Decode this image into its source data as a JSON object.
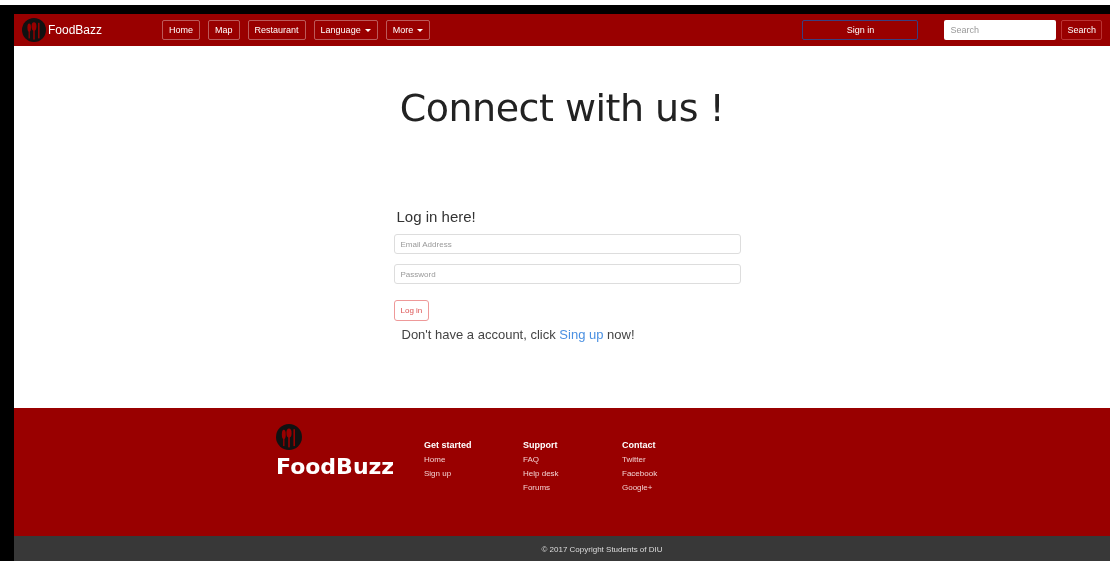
{
  "navbar": {
    "brand": "FoodBazz",
    "links": [
      {
        "label": "Home",
        "kind": "link"
      },
      {
        "label": "Map",
        "kind": "link"
      },
      {
        "label": "Restaurant",
        "kind": "link"
      },
      {
        "label": "Language",
        "kind": "dropdown"
      },
      {
        "label": "More",
        "kind": "dropdown"
      }
    ],
    "sign_in": "Sign in",
    "search": {
      "placeholder": "Search",
      "button": "Search"
    }
  },
  "heading": "Connect with us !",
  "login": {
    "title": "Log in here!",
    "email": {
      "placeholder": "Email Address"
    },
    "password": {
      "placeholder": "Password"
    },
    "button": "Log in",
    "prompt_before": "Don't have a account, click",
    "link": "Sing up",
    "prompt_after": "now!"
  },
  "footer": {
    "brand": "FoodBuzz",
    "columns": [
      {
        "title": "Get started",
        "links": [
          "Home",
          "Sign up"
        ]
      },
      {
        "title": "Support",
        "links": [
          "FAQ",
          "Help desk",
          "Forums"
        ]
      },
      {
        "title": "Contact",
        "links": [
          "Twitter",
          "Facebook",
          "Google+"
        ]
      }
    ],
    "copyright": "© 2017 Copyright Students of DIU"
  }
}
